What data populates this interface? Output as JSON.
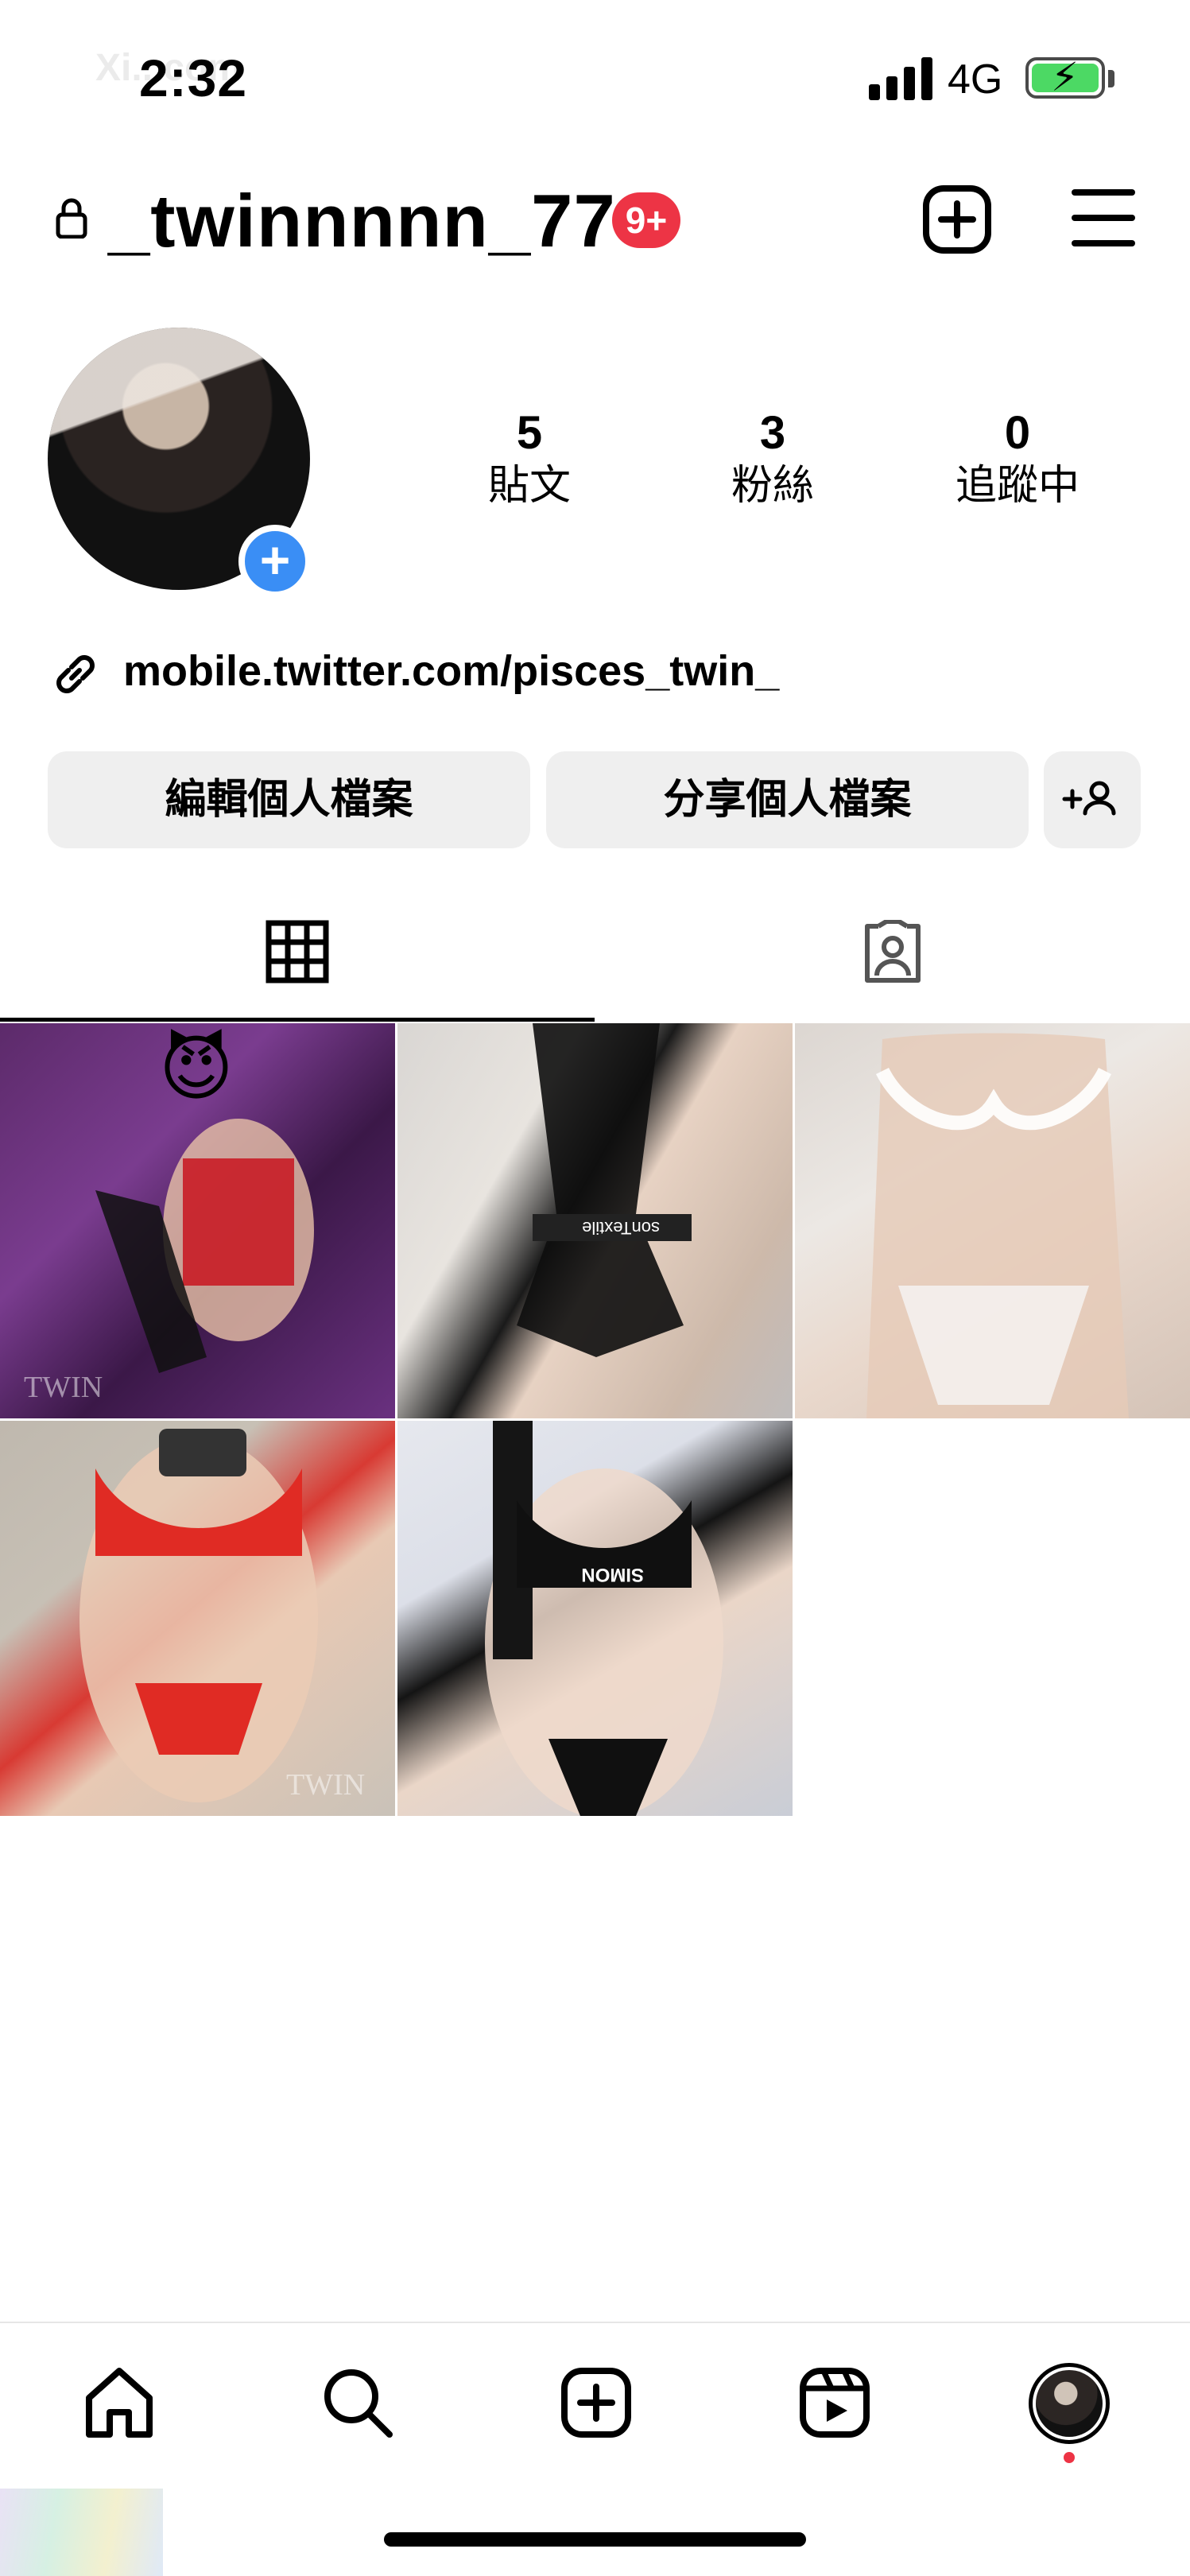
{
  "status_bar": {
    "time": "2:32",
    "network": "4G",
    "watermark": "Xi...com",
    "battery_charging": true,
    "battery_color": "#4cd964"
  },
  "header": {
    "username": "_twinnnnn_77",
    "notification_badge": "9+",
    "badge_color": "#ed3445",
    "create_icon": "plus-square-icon",
    "menu_icon": "hamburger-menu-icon",
    "lock_icon": "lock-icon"
  },
  "profile": {
    "avatar_add_icon": "plus-icon",
    "avatar_add_color": "#3a8ef5",
    "stats": [
      {
        "value": "5",
        "label": "貼文"
      },
      {
        "value": "3",
        "label": "粉絲"
      },
      {
        "value": "0",
        "label": "追蹤中"
      }
    ],
    "link": "mobile.twitter.com/pisces_twin_",
    "link_icon": "link-icon"
  },
  "actions": {
    "edit_profile": "編輯個人檔案",
    "share_profile": "分享個人檔案",
    "discover_people": "+8"
  },
  "tabs": [
    {
      "name": "grid",
      "icon": "grid-icon",
      "active": true
    },
    {
      "name": "tagged",
      "icon": "tagged-person-icon",
      "active": false
    }
  ],
  "posts": [
    {
      "overlay_emoji": "😈",
      "watermark": "TWIN"
    },
    {
      "overlay_emoji": "",
      "watermark": "sonTextile"
    },
    {
      "overlay_emoji": "",
      "watermark": ""
    },
    {
      "overlay_emoji": "",
      "watermark": "TWIN"
    },
    {
      "overlay_emoji": "",
      "watermark": "SIMON"
    }
  ],
  "bottom_nav": [
    {
      "name": "home",
      "icon": "home-icon"
    },
    {
      "name": "search",
      "icon": "search-icon"
    },
    {
      "name": "create",
      "icon": "plus-square-icon"
    },
    {
      "name": "reels",
      "icon": "reels-icon"
    },
    {
      "name": "profile",
      "icon": "profile-avatar"
    }
  ]
}
